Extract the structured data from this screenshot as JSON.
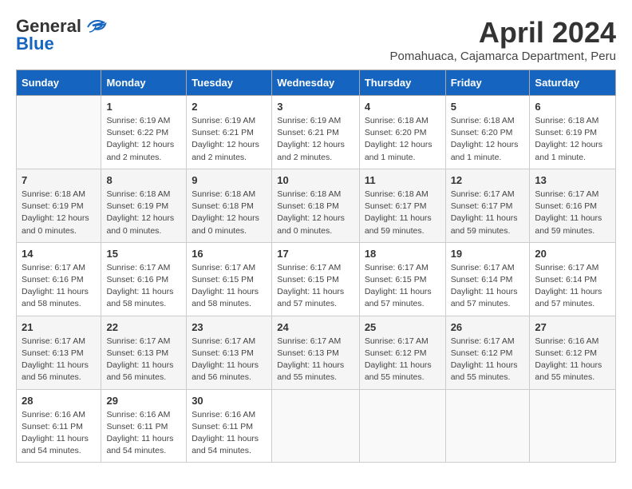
{
  "header": {
    "logo_general": "General",
    "logo_blue": "Blue",
    "month_title": "April 2024",
    "location": "Pomahuaca, Cajamarca Department, Peru"
  },
  "weekdays": [
    "Sunday",
    "Monday",
    "Tuesday",
    "Wednesday",
    "Thursday",
    "Friday",
    "Saturday"
  ],
  "weeks": [
    [
      {
        "day": "",
        "sunrise": "",
        "sunset": "",
        "daylight": ""
      },
      {
        "day": "1",
        "sunrise": "Sunrise: 6:19 AM",
        "sunset": "Sunset: 6:22 PM",
        "daylight": "Daylight: 12 hours and 2 minutes."
      },
      {
        "day": "2",
        "sunrise": "Sunrise: 6:19 AM",
        "sunset": "Sunset: 6:21 PM",
        "daylight": "Daylight: 12 hours and 2 minutes."
      },
      {
        "day": "3",
        "sunrise": "Sunrise: 6:19 AM",
        "sunset": "Sunset: 6:21 PM",
        "daylight": "Daylight: 12 hours and 2 minutes."
      },
      {
        "day": "4",
        "sunrise": "Sunrise: 6:18 AM",
        "sunset": "Sunset: 6:20 PM",
        "daylight": "Daylight: 12 hours and 1 minute."
      },
      {
        "day": "5",
        "sunrise": "Sunrise: 6:18 AM",
        "sunset": "Sunset: 6:20 PM",
        "daylight": "Daylight: 12 hours and 1 minute."
      },
      {
        "day": "6",
        "sunrise": "Sunrise: 6:18 AM",
        "sunset": "Sunset: 6:19 PM",
        "daylight": "Daylight: 12 hours and 1 minute."
      }
    ],
    [
      {
        "day": "7",
        "sunrise": "Sunrise: 6:18 AM",
        "sunset": "Sunset: 6:19 PM",
        "daylight": "Daylight: 12 hours and 0 minutes."
      },
      {
        "day": "8",
        "sunrise": "Sunrise: 6:18 AM",
        "sunset": "Sunset: 6:19 PM",
        "daylight": "Daylight: 12 hours and 0 minutes."
      },
      {
        "day": "9",
        "sunrise": "Sunrise: 6:18 AM",
        "sunset": "Sunset: 6:18 PM",
        "daylight": "Daylight: 12 hours and 0 minutes."
      },
      {
        "day": "10",
        "sunrise": "Sunrise: 6:18 AM",
        "sunset": "Sunset: 6:18 PM",
        "daylight": "Daylight: 12 hours and 0 minutes."
      },
      {
        "day": "11",
        "sunrise": "Sunrise: 6:18 AM",
        "sunset": "Sunset: 6:17 PM",
        "daylight": "Daylight: 11 hours and 59 minutes."
      },
      {
        "day": "12",
        "sunrise": "Sunrise: 6:17 AM",
        "sunset": "Sunset: 6:17 PM",
        "daylight": "Daylight: 11 hours and 59 minutes."
      },
      {
        "day": "13",
        "sunrise": "Sunrise: 6:17 AM",
        "sunset": "Sunset: 6:16 PM",
        "daylight": "Daylight: 11 hours and 59 minutes."
      }
    ],
    [
      {
        "day": "14",
        "sunrise": "Sunrise: 6:17 AM",
        "sunset": "Sunset: 6:16 PM",
        "daylight": "Daylight: 11 hours and 58 minutes."
      },
      {
        "day": "15",
        "sunrise": "Sunrise: 6:17 AM",
        "sunset": "Sunset: 6:16 PM",
        "daylight": "Daylight: 11 hours and 58 minutes."
      },
      {
        "day": "16",
        "sunrise": "Sunrise: 6:17 AM",
        "sunset": "Sunset: 6:15 PM",
        "daylight": "Daylight: 11 hours and 58 minutes."
      },
      {
        "day": "17",
        "sunrise": "Sunrise: 6:17 AM",
        "sunset": "Sunset: 6:15 PM",
        "daylight": "Daylight: 11 hours and 57 minutes."
      },
      {
        "day": "18",
        "sunrise": "Sunrise: 6:17 AM",
        "sunset": "Sunset: 6:15 PM",
        "daylight": "Daylight: 11 hours and 57 minutes."
      },
      {
        "day": "19",
        "sunrise": "Sunrise: 6:17 AM",
        "sunset": "Sunset: 6:14 PM",
        "daylight": "Daylight: 11 hours and 57 minutes."
      },
      {
        "day": "20",
        "sunrise": "Sunrise: 6:17 AM",
        "sunset": "Sunset: 6:14 PM",
        "daylight": "Daylight: 11 hours and 57 minutes."
      }
    ],
    [
      {
        "day": "21",
        "sunrise": "Sunrise: 6:17 AM",
        "sunset": "Sunset: 6:13 PM",
        "daylight": "Daylight: 11 hours and 56 minutes."
      },
      {
        "day": "22",
        "sunrise": "Sunrise: 6:17 AM",
        "sunset": "Sunset: 6:13 PM",
        "daylight": "Daylight: 11 hours and 56 minutes."
      },
      {
        "day": "23",
        "sunrise": "Sunrise: 6:17 AM",
        "sunset": "Sunset: 6:13 PM",
        "daylight": "Daylight: 11 hours and 56 minutes."
      },
      {
        "day": "24",
        "sunrise": "Sunrise: 6:17 AM",
        "sunset": "Sunset: 6:13 PM",
        "daylight": "Daylight: 11 hours and 55 minutes."
      },
      {
        "day": "25",
        "sunrise": "Sunrise: 6:17 AM",
        "sunset": "Sunset: 6:12 PM",
        "daylight": "Daylight: 11 hours and 55 minutes."
      },
      {
        "day": "26",
        "sunrise": "Sunrise: 6:17 AM",
        "sunset": "Sunset: 6:12 PM",
        "daylight": "Daylight: 11 hours and 55 minutes."
      },
      {
        "day": "27",
        "sunrise": "Sunrise: 6:16 AM",
        "sunset": "Sunset: 6:12 PM",
        "daylight": "Daylight: 11 hours and 55 minutes."
      }
    ],
    [
      {
        "day": "28",
        "sunrise": "Sunrise: 6:16 AM",
        "sunset": "Sunset: 6:11 PM",
        "daylight": "Daylight: 11 hours and 54 minutes."
      },
      {
        "day": "29",
        "sunrise": "Sunrise: 6:16 AM",
        "sunset": "Sunset: 6:11 PM",
        "daylight": "Daylight: 11 hours and 54 minutes."
      },
      {
        "day": "30",
        "sunrise": "Sunrise: 6:16 AM",
        "sunset": "Sunset: 6:11 PM",
        "daylight": "Daylight: 11 hours and 54 minutes."
      },
      {
        "day": "",
        "sunrise": "",
        "sunset": "",
        "daylight": ""
      },
      {
        "day": "",
        "sunrise": "",
        "sunset": "",
        "daylight": ""
      },
      {
        "day": "",
        "sunrise": "",
        "sunset": "",
        "daylight": ""
      },
      {
        "day": "",
        "sunrise": "",
        "sunset": "",
        "daylight": ""
      }
    ]
  ]
}
